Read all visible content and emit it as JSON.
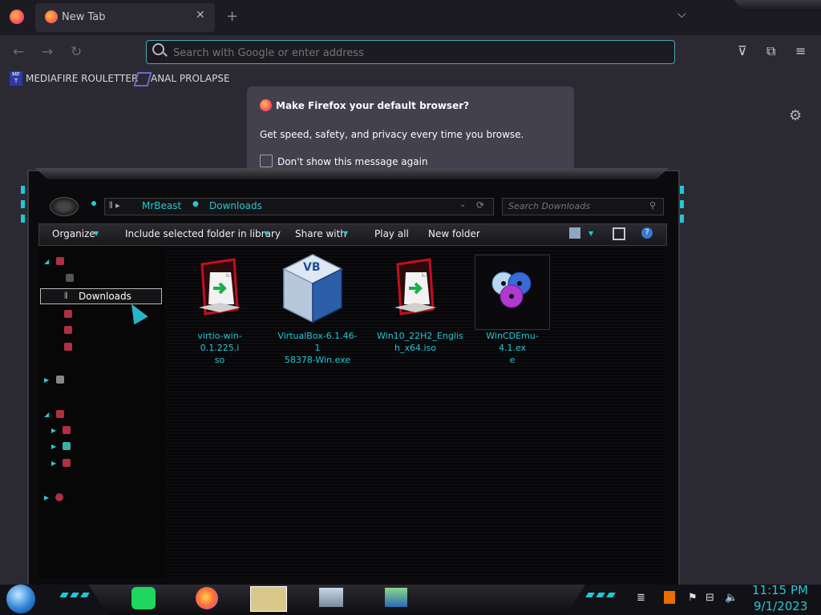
{
  "browser": {
    "tab": {
      "title": "New Tab",
      "close_glyph": "✕"
    },
    "new_tab_glyph": "+",
    "tab_list_glyph": "⌵",
    "urlbar": {
      "placeholder": "Search with Google or enter address"
    },
    "bookmarks": [
      {
        "icon_text": "MF\nT",
        "label": "MEDIAFIRE ROULETTER"
      },
      {
        "label": "ANAL PROLAPSE"
      }
    ],
    "popup": {
      "title": "Make Firefox your default browser?",
      "body": "Get speed, safety, and privacy every time you browse.",
      "checkbox_label": "Don't show this message again"
    }
  },
  "explorer": {
    "breadcrumb": [
      "MrBeast",
      "Downloads"
    ],
    "search_placeholder": "Search Downloads",
    "commands": [
      "Organize",
      "Include selected folder in library",
      "Share with",
      "Play all",
      "New folder"
    ],
    "nav_selected": "Downloads",
    "files": [
      {
        "name_line1": "virtio-win-0.1.225.i",
        "name_line2": "so",
        "icon": "iso-file-icon"
      },
      {
        "name_line1": "VirtualBox-6.1.46-1",
        "name_line2": "58378-Win.exe",
        "icon": "virtualbox-icon"
      },
      {
        "name_line1": "Win10_22H2_Englis",
        "name_line2": "h_x64.iso",
        "icon": "iso-file-icon"
      },
      {
        "name_line1": "WinCDEmu-4.1.ex",
        "name_line2": "e",
        "icon": "wincdemu-icon"
      }
    ]
  },
  "taskbar": {
    "clock_time": "11:15 PM",
    "clock_date": "9/1/2023"
  },
  "colors": {
    "accent_cyan": "#25c7d6",
    "firefox_bg": "#2b2a33",
    "explorer_bg": "#0b0b0d"
  }
}
